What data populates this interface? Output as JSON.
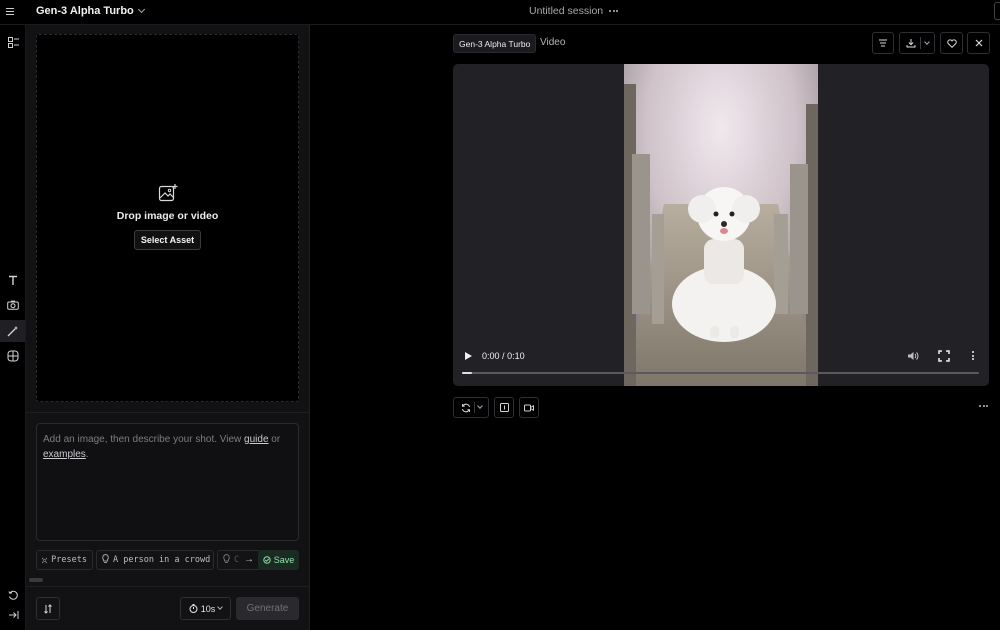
{
  "header": {
    "model_name": "Gen-3 Alpha Turbo",
    "session_title": "Untitled session"
  },
  "left_panel": {
    "drop_text": "Drop image or video",
    "select_asset_label": "Select Asset",
    "prompt": {
      "text_before_guide": "Add an image, then describe your shot. View ",
      "guide_link": "guide",
      "text_between": " or ",
      "examples_link": "examples",
      "text_after": "."
    },
    "chips": {
      "presets": "Presets",
      "suggestion_1": "A person in a crowd",
      "suggestion_2": "C",
      "save": "Save"
    },
    "duration_label": "10s",
    "generate_label": "Generate"
  },
  "output": {
    "model_tag": "Gen-3 Alpha Turbo",
    "type_tag": "Video",
    "player": {
      "current_time": "0:00",
      "separator": "/",
      "duration": "0:10",
      "progress": 0.0
    }
  },
  "colors": {
    "accent_save_bg": "#1b2a22",
    "accent_save_text": "#8ee0a8",
    "panel_bg": "#121214"
  }
}
